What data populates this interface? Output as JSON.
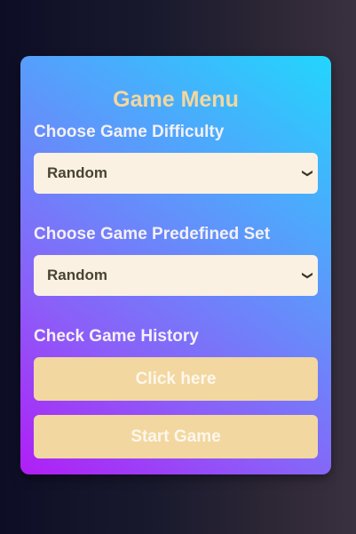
{
  "menu": {
    "title": "Game Menu",
    "difficulty": {
      "label": "Choose Game Difficulty",
      "selected": "Random"
    },
    "predefined_set": {
      "label": "Choose Game Predefined Set",
      "selected": "Random"
    },
    "history": {
      "label": "Check Game History",
      "button_label": "Click here"
    },
    "start_button_label": "Start Game"
  },
  "icons": {
    "dropdown": "chevron-down-icon"
  },
  "colors": {
    "title": "#f3d7a0",
    "button_bg": "#f2d7a0",
    "select_bg": "#faf1e3",
    "gradient_start": "#b01ef6",
    "gradient_end": "#22d6fd"
  }
}
